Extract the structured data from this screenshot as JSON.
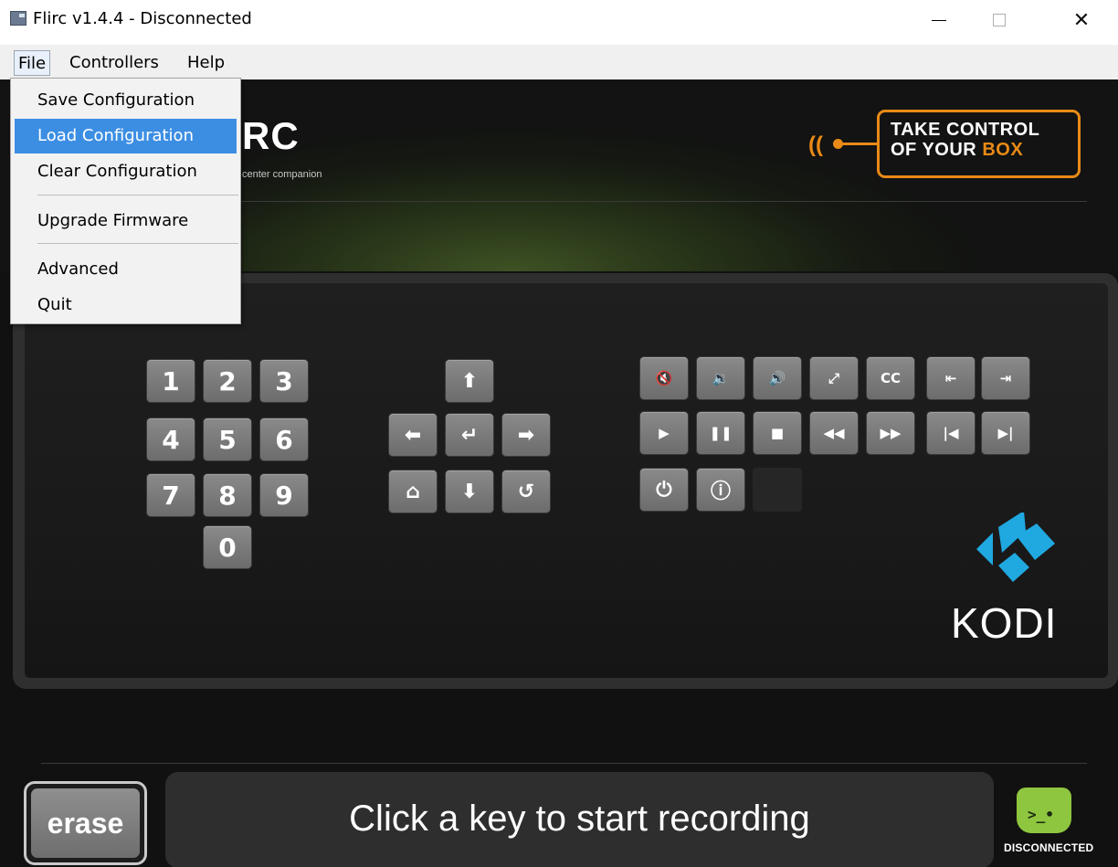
{
  "window": {
    "title": "Flirc v1.4.4 - Disconnected",
    "icon": "app-icon",
    "minimize_icon": "minimize-icon",
    "maximize_icon": "maximize-icon",
    "close_glyph": "✕"
  },
  "menubar": {
    "file": "File",
    "controllers": "Controllers",
    "help": "Help"
  },
  "file_menu": {
    "items": [
      {
        "label": "Save Configuration"
      },
      {
        "label": "Load Configuration",
        "highlighted": true
      },
      {
        "label": "Clear Configuration"
      },
      {
        "label": "Upgrade Firmware"
      },
      {
        "label": "Advanced"
      },
      {
        "label": "Quit"
      }
    ]
  },
  "header": {
    "logo_visible": "RC",
    "tagline_visible": "center companion",
    "badge_line1": "TAKE CONTROL",
    "badge_line2_prefix": "OF YOUR ",
    "badge_line2_accent": "BOX",
    "accent_color": "#e98a17"
  },
  "keypad": {
    "digits": [
      "1",
      "2",
      "3",
      "4",
      "5",
      "6",
      "7",
      "8",
      "9",
      "0"
    ]
  },
  "navigation": {
    "up": "⬆",
    "left": "⬅",
    "enter": "↵",
    "right": "➡",
    "home": "⌂",
    "down": "⬇",
    "back": "↺"
  },
  "media": {
    "mute": "🔇",
    "volume_down": "🔉",
    "volume_up": "🔊",
    "fullscreen": "⤢",
    "subtitles": "CC",
    "exit": "⇤",
    "enter_menu": "⇥",
    "play": "▶",
    "pause": "❚❚",
    "stop": "■",
    "rewind": "◀◀",
    "fast_forward": "▶▶",
    "previous": "|◀",
    "next": "▶|",
    "power": "⏻",
    "info": "ⓘ"
  },
  "branding": {
    "kodi_label": "KODI",
    "kodi_color": "#20a8e0"
  },
  "footer": {
    "erase_label": "erase",
    "prompt": "Click a key to start recording",
    "status": "DISCONNECTED",
    "status_color": "#8fc63f"
  }
}
